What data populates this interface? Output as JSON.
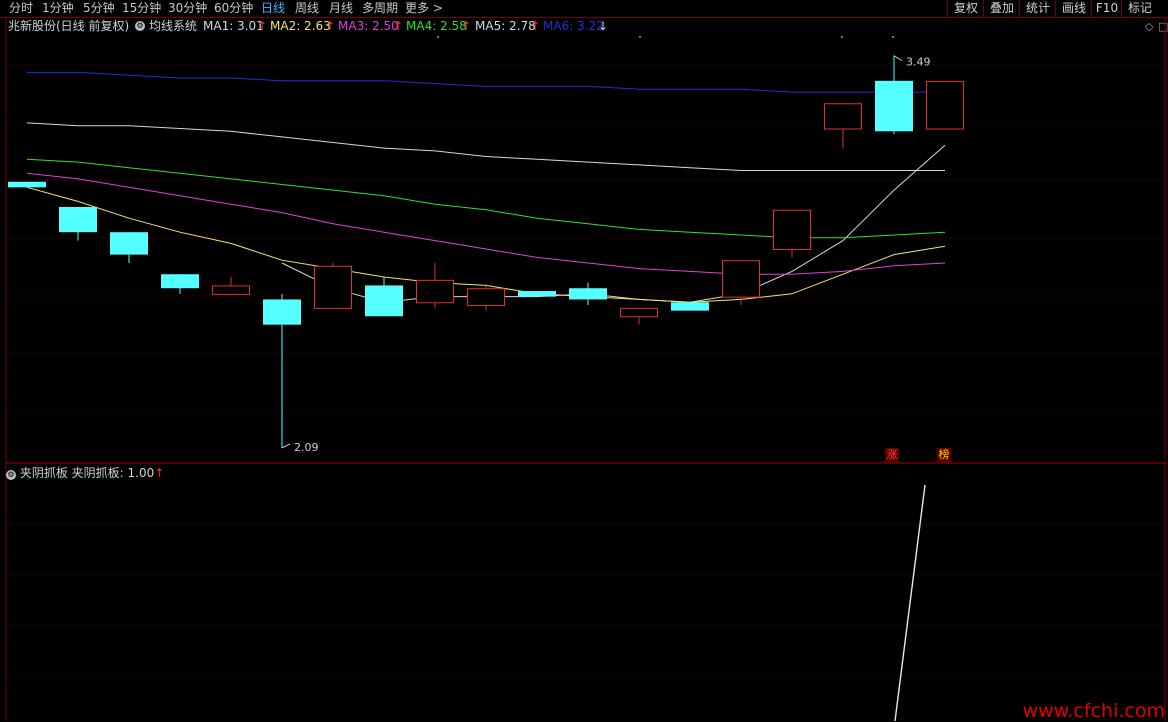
{
  "toolbar": {
    "periods": [
      "分时",
      "1分钟",
      "5分钟",
      "15分钟",
      "30分钟",
      "60分钟",
      "日线",
      "周线",
      "月线",
      "多周期",
      "更多 >"
    ],
    "active_period": "日线",
    "buttons": [
      "复权",
      "叠加",
      "统计",
      "画线",
      "F10",
      "标记"
    ]
  },
  "main_panel": {
    "stock_name": "兆新股份(日线 前复权)",
    "indicator_name": "均线系统",
    "ma": [
      {
        "label": "MA1: 3.01",
        "arrow": "↑",
        "color": "#d8d8d8"
      },
      {
        "label": "MA2: 2.63",
        "arrow": "↑",
        "color": "#f5e56b"
      },
      {
        "label": "MA3: 2.50",
        "arrow": "↑",
        "color": "#e040e0"
      },
      {
        "label": "MA4: 2.58",
        "arrow": "↑",
        "color": "#2ee02e"
      },
      {
        "label": "MA5: 2.78",
        "arrow": "↑",
        "color": "#d8d8d8"
      },
      {
        "label": "MA6: 3.22",
        "arrow": "↓",
        "color": "#2b2bd8"
      }
    ],
    "high_label": "3.49",
    "low_label": "2.09",
    "badges": [
      {
        "text": "涨",
        "color": "#ff3b3b",
        "bg": "#5a0000"
      },
      {
        "text": "榜",
        "color": "#ffcc00",
        "bg": "#5a0000"
      }
    ]
  },
  "sub_panel": {
    "indicator_name": "夹阴抓板",
    "value_label": "夹阴抓板: 1.00",
    "arrow": "↑"
  },
  "watermark": "www.cfchi.com",
  "colors": {
    "up": "#e03030",
    "down": "#54ffff",
    "grid": "#7a0000",
    "bg": "#000000"
  },
  "chart_data": {
    "type": "candlestick",
    "candles": [
      {
        "o": 3.04,
        "c": 3.02,
        "h": 3.04,
        "l": 3.02
      },
      {
        "o": 2.95,
        "c": 2.86,
        "h": 2.95,
        "l": 2.83
      },
      {
        "o": 2.86,
        "c": 2.78,
        "h": 2.86,
        "l": 2.75
      },
      {
        "o": 2.71,
        "c": 2.66,
        "h": 2.71,
        "l": 2.64
      },
      {
        "o": 2.64,
        "c": 2.67,
        "h": 2.7,
        "l": 2.64
      },
      {
        "o": 2.62,
        "c": 2.53,
        "h": 2.64,
        "l": 2.09
      },
      {
        "o": 2.59,
        "c": 2.74,
        "h": 2.75,
        "l": 2.59
      },
      {
        "o": 2.67,
        "c": 2.56,
        "h": 2.7,
        "l": 2.56
      },
      {
        "o": 2.61,
        "c": 2.69,
        "h": 2.75,
        "l": 2.59
      },
      {
        "o": 2.6,
        "c": 2.66,
        "h": 2.67,
        "l": 2.58
      },
      {
        "o": 2.65,
        "c": 2.63,
        "h": 2.65,
        "l": 2.63
      },
      {
        "o": 2.66,
        "c": 2.62,
        "h": 2.68,
        "l": 2.6
      },
      {
        "o": 2.56,
        "c": 2.59,
        "h": 2.59,
        "l": 2.53
      },
      {
        "o": 2.61,
        "c": 2.58,
        "h": 2.61,
        "l": 2.58
      },
      {
        "o": 2.63,
        "c": 2.76,
        "h": 2.76,
        "l": 2.6
      },
      {
        "o": 2.8,
        "c": 2.94,
        "h": 2.94,
        "l": 2.77
      },
      {
        "o": 3.23,
        "c": 3.32,
        "h": 3.32,
        "l": 3.16
      },
      {
        "o": 3.4,
        "c": 3.22,
        "h": 3.49,
        "l": 3.21
      },
      {
        "o": 3.23,
        "c": 3.4,
        "h": 3.4,
        "l": 3.23
      }
    ],
    "ma_series": [
      {
        "name": "MA1",
        "color": "#d8d8d8",
        "values": [
          null,
          null,
          null,
          null,
          null,
          2.75,
          2.66,
          2.61,
          2.63,
          2.63,
          2.63,
          2.64,
          2.62,
          2.61,
          2.64,
          2.72,
          2.83,
          3.01,
          3.17
        ]
      },
      {
        "name": "MA2",
        "color": "#f5e56b",
        "values": [
          3.02,
          2.97,
          2.91,
          2.86,
          2.82,
          2.76,
          2.73,
          2.7,
          2.68,
          2.67,
          2.64,
          2.63,
          2.62,
          2.61,
          2.62,
          2.64,
          2.71,
          2.78,
          2.81
        ]
      },
      {
        "name": "MA3",
        "color": "#e040e0",
        "values": [
          3.07,
          3.05,
          3.02,
          2.99,
          2.96,
          2.93,
          2.89,
          2.86,
          2.83,
          2.8,
          2.77,
          2.75,
          2.73,
          2.72,
          2.71,
          2.71,
          2.72,
          2.74,
          2.75
        ]
      },
      {
        "name": "MA4",
        "color": "#2ee02e",
        "values": [
          3.12,
          3.11,
          3.09,
          3.07,
          3.05,
          3.03,
          3.01,
          2.99,
          2.96,
          2.94,
          2.91,
          2.89,
          2.87,
          2.86,
          2.85,
          2.84,
          2.84,
          2.85,
          2.86
        ]
      },
      {
        "name": "MA5",
        "color": "#d8d8d8",
        "values": [
          3.25,
          3.24,
          3.24,
          3.23,
          3.22,
          3.2,
          3.18,
          3.16,
          3.15,
          3.13,
          3.12,
          3.11,
          3.1,
          3.09,
          3.08,
          3.08,
          3.08,
          3.08,
          3.08
        ]
      },
      {
        "name": "MA6",
        "color": "#2b2bd8",
        "values": [
          3.43,
          3.43,
          3.42,
          3.41,
          3.41,
          3.4,
          3.4,
          3.4,
          3.39,
          3.38,
          3.38,
          3.38,
          3.37,
          3.37,
          3.37,
          3.36,
          3.36,
          3.36,
          3.36
        ]
      }
    ],
    "ylim": [
      2.04,
      3.56
    ],
    "sub_indicator": {
      "name": "夹阴抓板",
      "values": [
        0,
        0,
        0,
        0,
        0,
        0,
        0,
        0,
        0,
        0,
        0,
        0,
        0,
        0,
        0,
        0,
        0,
        0,
        1
      ]
    }
  }
}
